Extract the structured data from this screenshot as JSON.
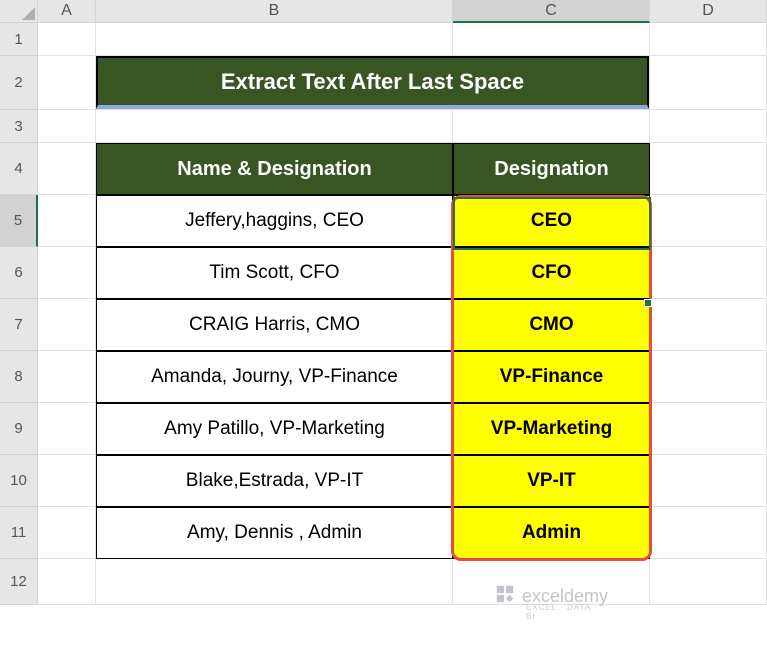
{
  "columns": [
    "A",
    "B",
    "C",
    "D"
  ],
  "rows": [
    "1",
    "2",
    "3",
    "4",
    "5",
    "6",
    "7",
    "8",
    "9",
    "10",
    "11",
    "12"
  ],
  "selected_column": "C",
  "selected_row": "5",
  "title": "Extract Text After Last Space",
  "header": {
    "b": "Name & Designation",
    "c": "Designation"
  },
  "chart_data": {
    "type": "table",
    "title": "Extract Text After Last Space",
    "columns": [
      "Name & Designation",
      "Designation"
    ],
    "rows": [
      {
        "name": "Jeffery,haggins, CEO",
        "designation": "CEO"
      },
      {
        "name": "Tim Scott, CFO",
        "designation": "CFO"
      },
      {
        "name": "CRAIG Harris, CMO",
        "designation": "CMO"
      },
      {
        "name": "Amanda, Journy, VP-Finance",
        "designation": "VP-Finance"
      },
      {
        "name": "Amy Patillo, VP-Marketing",
        "designation": "VP-Marketing"
      },
      {
        "name": "Blake,Estrada, VP-IT",
        "designation": "VP-IT"
      },
      {
        "name": "Amy, Dennis , Admin",
        "designation": "Admin"
      }
    ]
  },
  "watermark": {
    "text": "exceldemy",
    "sub": "EXCEL · DATA · BI"
  }
}
